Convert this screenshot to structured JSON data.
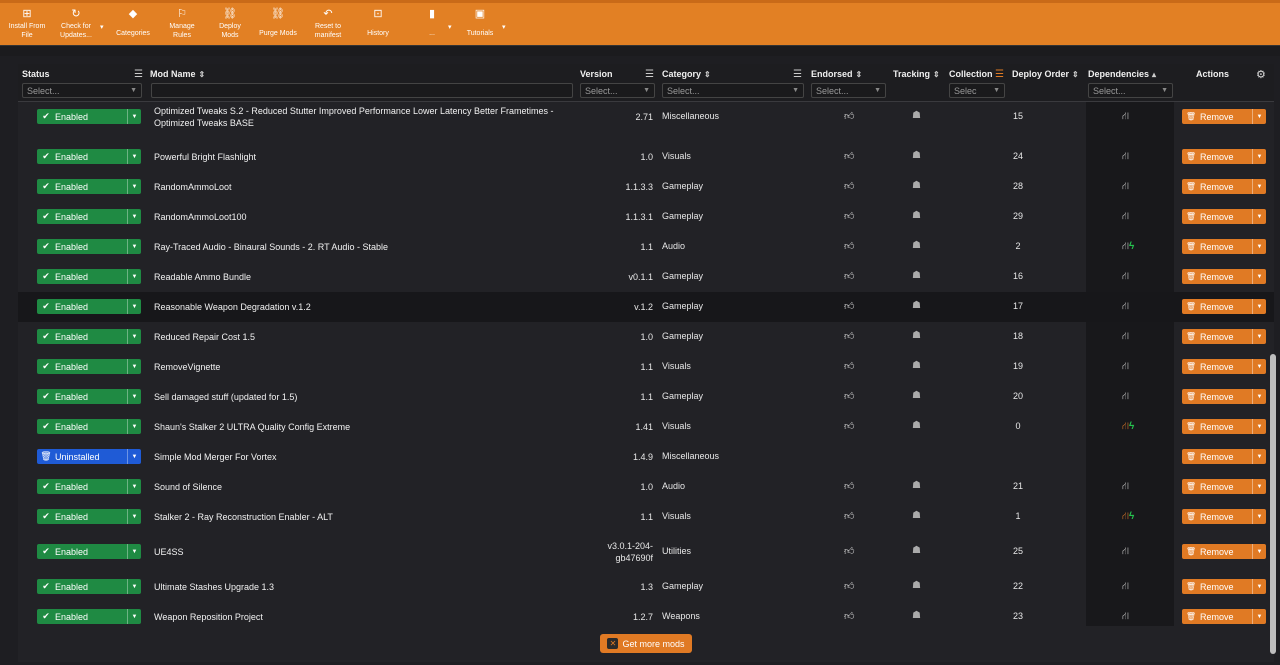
{
  "toolbar": {
    "buttons": [
      {
        "label": "Install From File",
        "icon": "plus-box-icon"
      },
      {
        "label": "Check for Updates...",
        "icon": "refresh-icon"
      },
      {
        "label": "Categories",
        "icon": "tag-icon"
      },
      {
        "label": "Manage Rules",
        "icon": "rules-icon"
      },
      {
        "label": "Deploy Mods",
        "icon": "link-icon"
      },
      {
        "label": "Purge Mods",
        "icon": "unlink-icon"
      },
      {
        "label": "Reset to manifest",
        "icon": "undo-icon"
      },
      {
        "label": "History",
        "icon": "history-icon"
      },
      {
        "label": "...",
        "icon": "folder-icon"
      },
      {
        "label": "Tutorials",
        "icon": "video-icon"
      }
    ]
  },
  "table": {
    "headers": {
      "status": "Status",
      "mod_name": "Mod Name",
      "version": "Version",
      "category": "Category",
      "endorsed": "Endorsed",
      "tracking": "Tracking",
      "collection": "Collection",
      "deploy_order": "Deploy Order",
      "dependencies": "Dependencies",
      "actions": "Actions"
    },
    "filters": {
      "status": "Select...",
      "version": "Select...",
      "category": "Select...",
      "endorsed": "Select...",
      "collection": "Selec",
      "dependencies": "Select..."
    },
    "rows": [
      {
        "status": "Enabled",
        "name": "Optimized Tweaks S.2 - Reduced Stutter Improved Performance Lower Latency Better Frametimes - Optimized Tweaks BASE",
        "version": "2.71",
        "category": "Miscellaneous",
        "order": "15",
        "deps": "ok",
        "action": "Remove"
      },
      {
        "status": "Enabled",
        "name": "Powerful Bright Flashlight",
        "version": "1.0",
        "category": "Visuals",
        "order": "24",
        "deps": "ok",
        "action": "Remove"
      },
      {
        "status": "Enabled",
        "name": "RandomAmmoLoot",
        "version": "1.1.3.3",
        "category": "Gameplay",
        "order": "28",
        "deps": "ok",
        "action": "Remove"
      },
      {
        "status": "Enabled",
        "name": "RandomAmmoLoot100",
        "version": "1.1.3.1",
        "category": "Gameplay",
        "order": "29",
        "deps": "ok",
        "action": "Remove"
      },
      {
        "status": "Enabled",
        "name": "Ray-Traced Audio - Binaural Sounds - 2. RT Audio - Stable",
        "version": "1.1",
        "category": "Audio",
        "order": "2",
        "deps": "ok-bolt",
        "action": "Remove"
      },
      {
        "status": "Enabled",
        "name": "Readable Ammo Bundle",
        "version": "v0.1.1",
        "category": "Gameplay",
        "order": "16",
        "deps": "ok",
        "action": "Remove"
      },
      {
        "status": "Enabled",
        "name": "Reasonable Weapon Degradation v.1.2",
        "version": "v.1.2",
        "category": "Gameplay",
        "order": "17",
        "deps": "ok",
        "action": "Remove"
      },
      {
        "status": "Enabled",
        "name": "Reduced Repair Cost 1.5",
        "version": "1.0",
        "category": "Gameplay",
        "order": "18",
        "deps": "ok",
        "action": "Remove"
      },
      {
        "status": "Enabled",
        "name": "RemoveVignette",
        "version": "1.1",
        "category": "Visuals",
        "order": "19",
        "deps": "ok",
        "action": "Remove"
      },
      {
        "status": "Enabled",
        "name": "Sell damaged stuff (updated for 1.5)",
        "version": "1.1",
        "category": "Gameplay",
        "order": "20",
        "deps": "ok",
        "action": "Remove"
      },
      {
        "status": "Enabled",
        "name": "Shaun's Stalker 2 ULTRA Quality Config Extreme",
        "version": "1.41",
        "category": "Visuals",
        "order": "0",
        "deps": "warn-bolt",
        "action": "Remove"
      },
      {
        "status": "Uninstalled",
        "name": "Simple Mod Merger For Vortex",
        "version": "1.4.9",
        "category": "Miscellaneous",
        "order": "",
        "deps": "none",
        "action": "Remove"
      },
      {
        "status": "Enabled",
        "name": "Sound of Silence",
        "version": "1.0",
        "category": "Audio",
        "order": "21",
        "deps": "ok",
        "action": "Remove"
      },
      {
        "status": "Enabled",
        "name": "Stalker 2 - Ray Reconstruction Enabler - ALT",
        "version": "1.1",
        "category": "Visuals",
        "order": "1",
        "deps": "warn-bolt",
        "action": "Remove"
      },
      {
        "status": "Enabled",
        "name": "UE4SS",
        "version": "v3.0.1-204-gb47690f",
        "category": "Utilities",
        "order": "25",
        "deps": "ok",
        "action": "Remove"
      },
      {
        "status": "Enabled",
        "name": "Ultimate Stashes Upgrade 1.3",
        "version": "1.3",
        "category": "Gameplay",
        "order": "22",
        "deps": "ok",
        "action": "Remove"
      },
      {
        "status": "Enabled",
        "name": "Weapon Reposition Project",
        "version": "1.2.7",
        "category": "Weapons",
        "order": "23",
        "deps": "ok",
        "action": "Remove"
      }
    ]
  },
  "footer": {
    "get_more": "Get more mods"
  },
  "colors": {
    "accent": "#e28024",
    "enabled": "#1f8a43",
    "uninstalled": "#1f5bd6"
  }
}
